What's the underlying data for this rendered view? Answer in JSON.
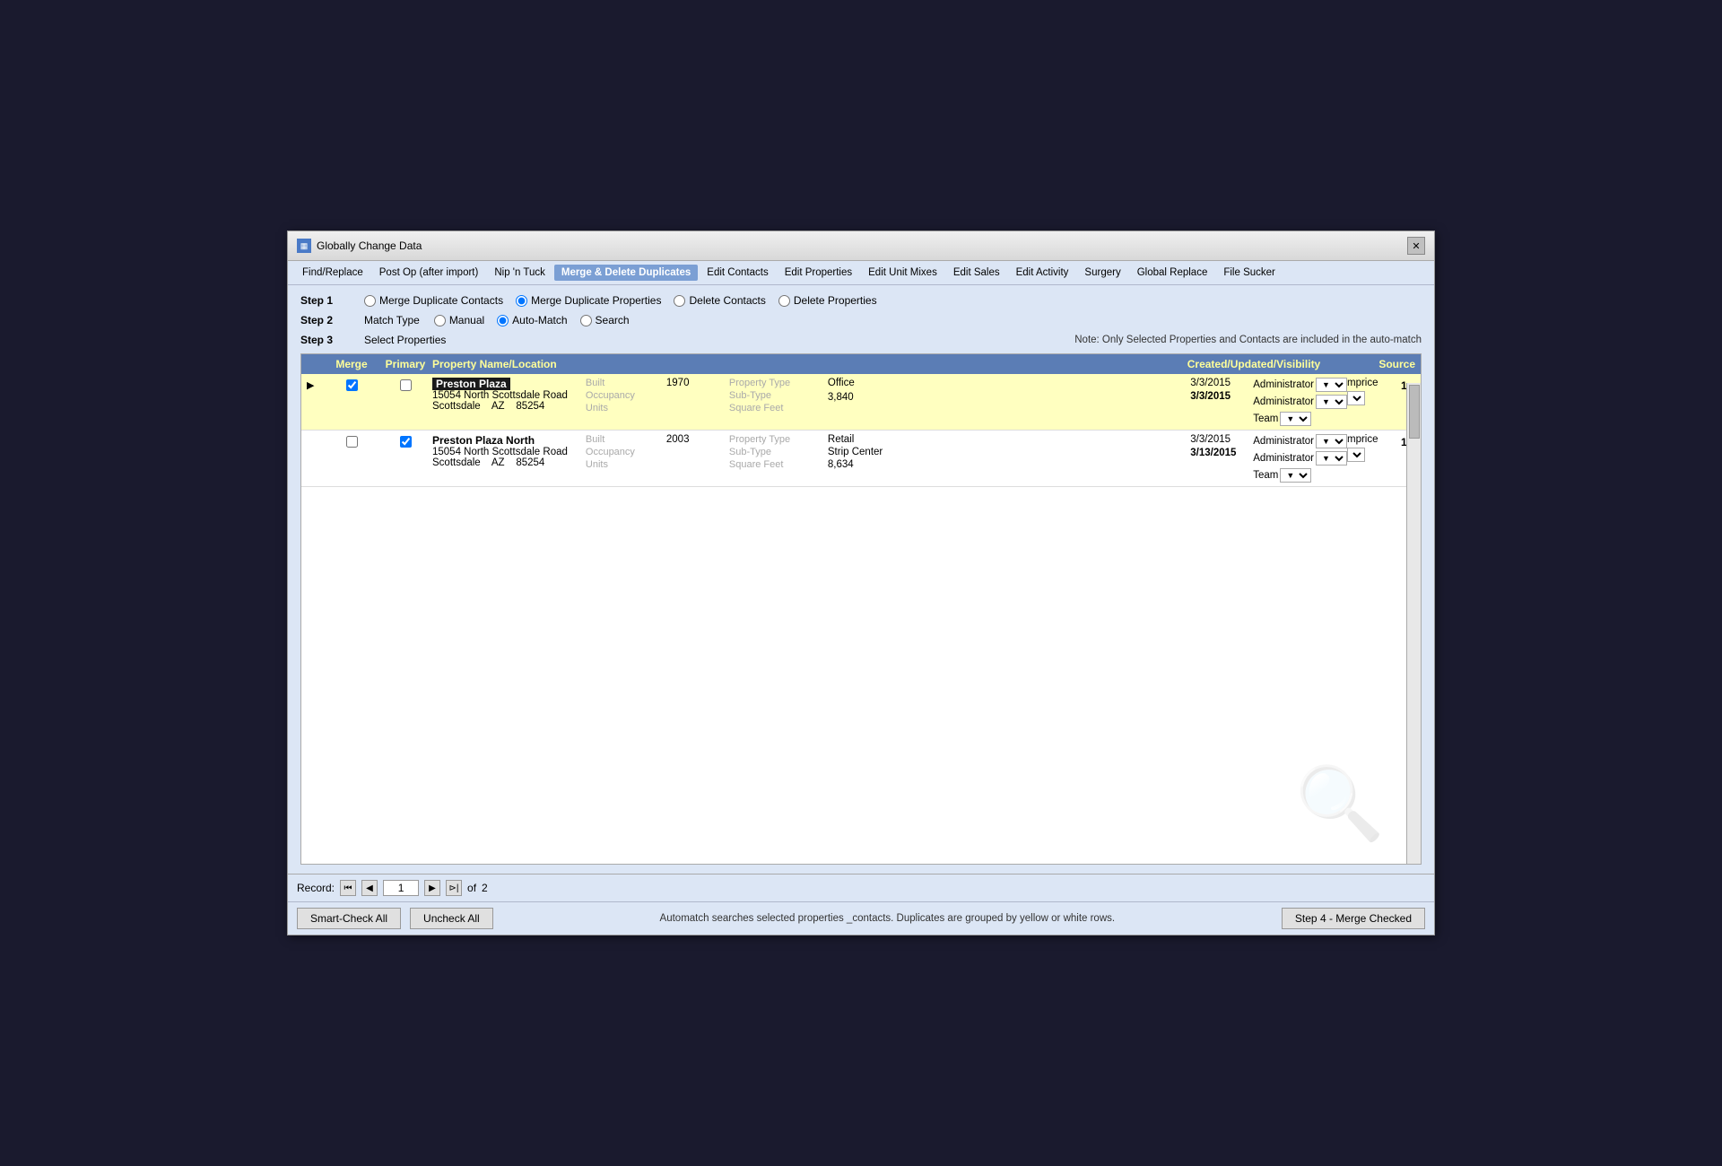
{
  "window": {
    "title": "Globally Change Data",
    "closeBtn": "✕"
  },
  "menuBar": {
    "items": [
      {
        "id": "find-replace",
        "label": "Find/Replace",
        "active": false
      },
      {
        "id": "post-op",
        "label": "Post Op (after import)",
        "active": false
      },
      {
        "id": "nip-tuck",
        "label": "Nip 'n Tuck",
        "active": false
      },
      {
        "id": "merge-delete",
        "label": "Merge & Delete Duplicates",
        "active": true
      },
      {
        "id": "edit-contacts",
        "label": "Edit Contacts",
        "active": false
      },
      {
        "id": "edit-properties",
        "label": "Edit Properties",
        "active": false
      },
      {
        "id": "edit-unit-mixes",
        "label": "Edit Unit Mixes",
        "active": false
      },
      {
        "id": "edit-sales",
        "label": "Edit Sales",
        "active": false
      },
      {
        "id": "edit-activity",
        "label": "Edit Activity",
        "active": false
      },
      {
        "id": "surgery",
        "label": "Surgery",
        "active": false
      },
      {
        "id": "global-replace",
        "label": "Global Replace",
        "active": false
      },
      {
        "id": "file-sucker",
        "label": "File Sucker",
        "active": false
      }
    ]
  },
  "steps": {
    "step1": {
      "label": "Step 1",
      "options": [
        {
          "id": "merge-contacts",
          "label": "Merge Duplicate Contacts",
          "checked": false
        },
        {
          "id": "merge-properties",
          "label": "Merge Duplicate Properties",
          "checked": true
        },
        {
          "id": "delete-contacts",
          "label": "Delete Contacts",
          "checked": false
        },
        {
          "id": "delete-properties",
          "label": "Delete Properties",
          "checked": false
        }
      ]
    },
    "step2": {
      "label": "Step 2",
      "subLabel": "Match Type",
      "options": [
        {
          "id": "manual",
          "label": "Manual",
          "checked": false
        },
        {
          "id": "auto-match",
          "label": "Auto-Match",
          "checked": true
        },
        {
          "id": "search",
          "label": "Search",
          "checked": false
        }
      ]
    },
    "step3": {
      "label": "Step 3",
      "subLabel": "Select Properties",
      "note": "Note:  Only Selected Properties and Contacts are included in the auto-match"
    }
  },
  "tableHeader": {
    "columns": [
      "",
      "Merge",
      "Primary",
      "Property Name/Location",
      "Created/Updated/Visibility",
      "Source"
    ]
  },
  "properties": [
    {
      "group": 1,
      "rows": [
        {
          "arrow": "▶",
          "merge": true,
          "primary": false,
          "highlighted": true,
          "nameHighlighted": true,
          "name": "Preston Plaza",
          "address": "15054 North Scottsdale Road",
          "city": "Scottsdale",
          "state": "AZ",
          "zip": "85254",
          "built": "Built",
          "builtVal": "1970",
          "occupancy": "Occupancy",
          "units": "Units",
          "propertyType": "Property Type",
          "propertyTypeVal": "Office",
          "subType": "Sub-Type",
          "subTypeVal": "",
          "squareFeet": "Square Feet",
          "squareFeetVal": "3,840",
          "date1": "3/3/2015",
          "date2": "3/3/2015",
          "vis1": "Administrator",
          "vis2": "Administrator",
          "vis3": "Team",
          "source1": "mprice",
          "groupNum": "1"
        },
        {
          "arrow": "",
          "merge": false,
          "primary": true,
          "highlighted": false,
          "nameHighlighted": false,
          "name": "Preston Plaza North",
          "address": "15054 North Scottsdale Road",
          "city": "Scottsdale",
          "state": "AZ",
          "zip": "85254",
          "built": "Built",
          "builtVal": "2003",
          "occupancy": "Occupancy",
          "units": "Units",
          "propertyType": "Property Type",
          "propertyTypeVal": "Retail",
          "subType": "Sub-Type",
          "subTypeVal": "Strip Center",
          "squareFeet": "Square Feet",
          "squareFeetVal": "8,634",
          "date1": "3/3/2015",
          "date2": "3/13/2015",
          "vis1": "Administrator",
          "vis2": "Administrator",
          "vis3": "Team",
          "source1": "mprice",
          "groupNum": "1"
        }
      ]
    }
  ],
  "pagination": {
    "firstLabel": "⏮",
    "prevLabel": "◀",
    "nextLabel": "▶",
    "lastLabel": "⏭",
    "endLabel": "⊳|",
    "currentPage": "1",
    "ofLabel": "of",
    "totalPages": "2"
  },
  "bottomBar": {
    "smartCheckAll": "Smart-Check All",
    "uncheckAll": "Uncheck All",
    "statusText": "Automatch searches selected properties _contacts. Duplicates are grouped by yellow or white rows.",
    "mergeChecked": "Step 4 - Merge Checked"
  }
}
